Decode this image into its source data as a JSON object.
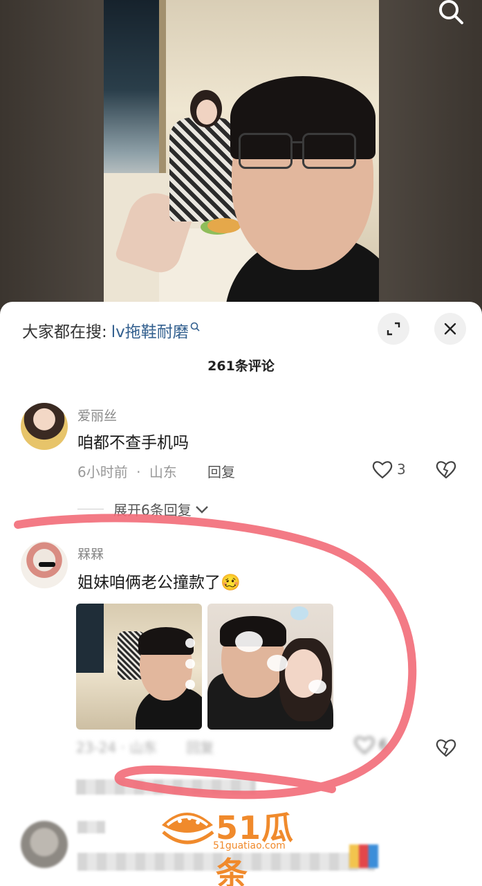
{
  "hot_search": {
    "prefix": "大家都在搜:",
    "term": "lv拖鞋耐磨"
  },
  "comment_count": "261条评论",
  "comments": [
    {
      "username": "爱丽丝",
      "text": "咱都不查手机吗",
      "time": "6小时前",
      "separator": "·",
      "location": "山东",
      "reply_label": "回复",
      "likes": "3"
    },
    {
      "username": "槑槑",
      "text": "姐妹咱俩老公撞款了",
      "emoji": "🥴",
      "blurred_meta": "23-24 · 山东",
      "reply_label": "回复",
      "likes": "6"
    }
  ],
  "expand_replies": "展开6条回复",
  "watermark": {
    "brand": "51瓜条",
    "url": "51guatiao.com"
  },
  "colors": {
    "link_blue": "#33608f",
    "annotation_red": "#f26b78",
    "watermark_orange": "#f08a2c"
  },
  "icons": [
    "search-icon",
    "expand-icon",
    "close-icon",
    "heart-icon",
    "dislike-heart-icon",
    "chevron-down-icon"
  ]
}
